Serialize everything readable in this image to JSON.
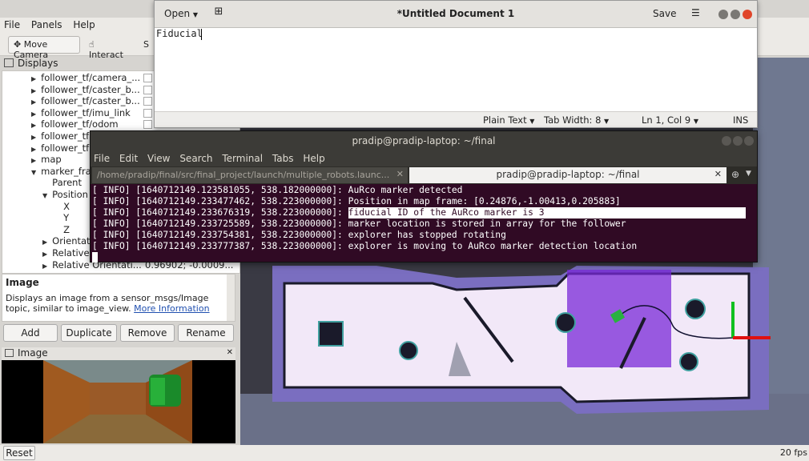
{
  "rviz": {
    "menu": [
      "File",
      "Panels",
      "Help"
    ],
    "tools": [
      "Move Camera",
      "Interact",
      "S"
    ],
    "displays_title": "Displays",
    "tree": [
      {
        "label": "follower_tf/camera_...",
        "indent": 1,
        "arrow": "▶"
      },
      {
        "label": "follower_tf/caster_b...",
        "indent": 1,
        "arrow": "▶"
      },
      {
        "label": "follower_tf/caster_b...",
        "indent": 1,
        "arrow": "▶"
      },
      {
        "label": "follower_tf/imu_link",
        "indent": 1,
        "arrow": "▶"
      },
      {
        "label": "follower_tf/odom",
        "indent": 1,
        "arrow": "▶"
      },
      {
        "label": "follower_tf",
        "indent": 1,
        "arrow": "▶"
      },
      {
        "label": "follower_tf",
        "indent": 1,
        "arrow": "▶"
      },
      {
        "label": "map",
        "indent": 1,
        "arrow": "▶"
      },
      {
        "label": "marker_fra",
        "indent": 1,
        "arrow": "▼"
      },
      {
        "label": "Parent",
        "indent": 2,
        "arrow": ""
      },
      {
        "label": "Position",
        "indent": 2,
        "arrow": "▼"
      },
      {
        "label": "X",
        "indent": 3,
        "arrow": ""
      },
      {
        "label": "Y",
        "indent": 3,
        "arrow": ""
      },
      {
        "label": "Z",
        "indent": 3,
        "arrow": ""
      },
      {
        "label": "Orientati",
        "indent": 2,
        "arrow": "▶"
      },
      {
        "label": "Relative",
        "indent": 2,
        "arrow": "▶"
      },
      {
        "label": "Relative Orientati...",
        "indent": 2,
        "arrow": "▶"
      }
    ],
    "relative_orientation_value": "0.96902; -0.0009...",
    "help_title": "Image",
    "help_text": "Displays an image from a sensor_msgs/Image topic, similar to image_view.",
    "help_link": "More Information",
    "buttons": [
      "Add",
      "Duplicate",
      "Remove",
      "Rename"
    ],
    "image_panel_title": "Image",
    "reset_label": "Reset",
    "fps": "20 fps"
  },
  "gedit": {
    "open_label": "Open",
    "title": "*Untitled Document 1",
    "save_label": "Save",
    "content": "Fiducial",
    "status": {
      "language": "Plain Text",
      "tab_width": "Tab Width: 8",
      "position": "Ln 1, Col 9",
      "mode": "INS"
    }
  },
  "terminal": {
    "title": "pradip@pradip-laptop: ~/final",
    "menu": [
      "File",
      "Edit",
      "View",
      "Search",
      "Terminal",
      "Tabs",
      "Help"
    ],
    "tab1": "/home/pradip/final/src/final_project/launch/multiple_robots.launc...",
    "tab2": "pradip@pradip-laptop: ~/final",
    "lines": [
      "[ INFO] [1640712149.123581055, 538.182000000]: AuRco marker detected",
      "[ INFO] [1640712149.233477462, 538.223000000]: Position in map frame: [0.24876,-1.00413,0.205883]",
      "[ INFO] [1640712149.233676319, 538.223000000]: ",
      "[ INFO] [1640712149.233725589, 538.223000000]: marker location is stored in array for the follower",
      "[ INFO] [1640712149.233754381, 538.223000000]: explorer has stopped rotating",
      "[ INFO] [1640712149.233777387, 538.223000000]: explorer is moving to AuRco marker detection location"
    ],
    "highlighted": "fiducial ID of the AuRco marker is 3"
  }
}
